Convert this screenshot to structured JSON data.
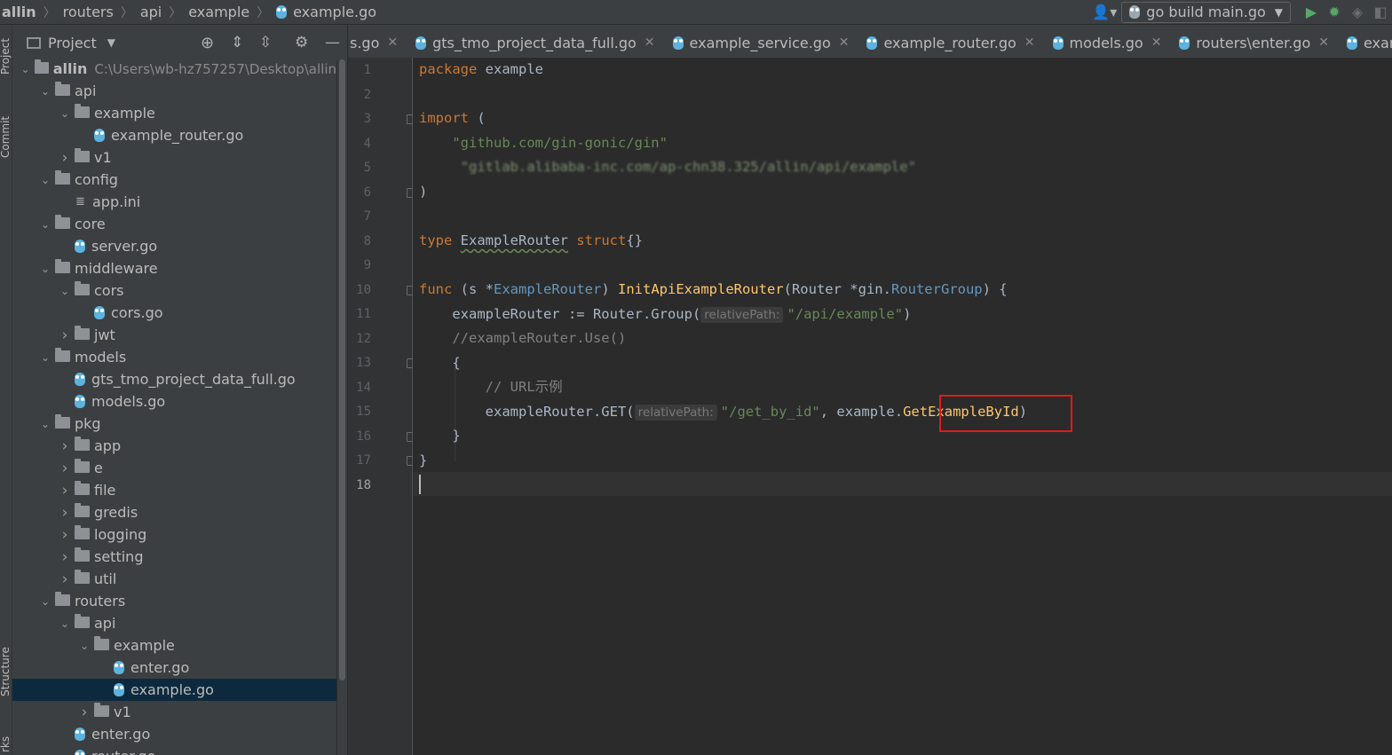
{
  "breadcrumb": [
    "allin",
    "routers",
    "api",
    "example",
    "example.go"
  ],
  "toolbar": {
    "run_config_label": "go build main.go",
    "icons": [
      "user-icon",
      "run-icon",
      "debug-icon",
      "coverage-icon",
      "stop-icon"
    ]
  },
  "side_strip": {
    "top_label": "Project",
    "mid_label": "Commit",
    "bottom_label": "Structure",
    "bottom2_label": "rks"
  },
  "project_panel": {
    "title": "Project",
    "root_name": "allin",
    "root_path": "C:\\Users\\wb-hz757257\\Desktop\\allin",
    "tree": [
      {
        "label": "api",
        "type": "folder",
        "expanded": true,
        "depth": 1
      },
      {
        "label": "example",
        "type": "folder",
        "expanded": true,
        "depth": 2
      },
      {
        "label": "example_router.go",
        "type": "go",
        "depth": 3
      },
      {
        "label": "v1",
        "type": "folder",
        "expanded": false,
        "depth": 2
      },
      {
        "label": "config",
        "type": "folder",
        "expanded": true,
        "depth": 1
      },
      {
        "label": "app.ini",
        "type": "ini",
        "depth": 2
      },
      {
        "label": "core",
        "type": "folder",
        "expanded": true,
        "depth": 1
      },
      {
        "label": "server.go",
        "type": "go",
        "depth": 2
      },
      {
        "label": "middleware",
        "type": "folder",
        "expanded": true,
        "depth": 1
      },
      {
        "label": "cors",
        "type": "folder",
        "expanded": true,
        "depth": 2
      },
      {
        "label": "cors.go",
        "type": "go",
        "depth": 3
      },
      {
        "label": "jwt",
        "type": "folder",
        "expanded": false,
        "depth": 2
      },
      {
        "label": "models",
        "type": "folder",
        "expanded": true,
        "depth": 1
      },
      {
        "label": "gts_tmo_project_data_full.go",
        "type": "go",
        "depth": 2
      },
      {
        "label": "models.go",
        "type": "go",
        "depth": 2
      },
      {
        "label": "pkg",
        "type": "folder",
        "expanded": true,
        "depth": 1
      },
      {
        "label": "app",
        "type": "folder",
        "expanded": false,
        "depth": 2
      },
      {
        "label": "e",
        "type": "folder",
        "expanded": false,
        "depth": 2
      },
      {
        "label": "file",
        "type": "folder",
        "expanded": false,
        "depth": 2
      },
      {
        "label": "gredis",
        "type": "folder",
        "expanded": false,
        "depth": 2
      },
      {
        "label": "logging",
        "type": "folder",
        "expanded": false,
        "depth": 2
      },
      {
        "label": "setting",
        "type": "folder",
        "expanded": false,
        "depth": 2
      },
      {
        "label": "util",
        "type": "folder",
        "expanded": false,
        "depth": 2
      },
      {
        "label": "routers",
        "type": "folder",
        "expanded": true,
        "depth": 1
      },
      {
        "label": "api",
        "type": "folder",
        "expanded": true,
        "depth": 2
      },
      {
        "label": "example",
        "type": "folder",
        "expanded": true,
        "depth": 3
      },
      {
        "label": "enter.go",
        "type": "go",
        "depth": 4
      },
      {
        "label": "example.go",
        "type": "go",
        "depth": 4,
        "selected": true
      },
      {
        "label": "v1",
        "type": "folder",
        "expanded": false,
        "depth": 3
      },
      {
        "label": "enter.go",
        "type": "go",
        "depth": 2
      },
      {
        "label": "router.go",
        "type": "go",
        "depth": 2
      }
    ]
  },
  "tabs": [
    {
      "label": "s.go",
      "icon": false
    },
    {
      "label": "gts_tmo_project_data_full.go",
      "icon": true
    },
    {
      "label": "example_service.go",
      "icon": true
    },
    {
      "label": "example_router.go",
      "icon": true
    },
    {
      "label": "models.go",
      "icon": true
    },
    {
      "label": "routers\\enter.go",
      "icon": true
    },
    {
      "label": "example\\",
      "icon": true
    }
  ],
  "editor": {
    "current_line": 18,
    "line_numbers": [
      "1",
      "2",
      "3",
      "4",
      "5",
      "6",
      "7",
      "8",
      "9",
      "10",
      "11",
      "12",
      "13",
      "14",
      "15",
      "16",
      "17",
      "18"
    ],
    "code": {
      "l1_kw": "package",
      "l1_name": " example",
      "l3_kw": "import",
      "l3_paren": " (",
      "l4_str": "\"github.com/gin-gonic/gin\"",
      "l5_blur": "\"gitlab.alibaba-inc.com/ap-chn38.325/allin/api/example\"",
      "l6": ")",
      "l8_kw": "type",
      "l8_name": "ExampleRouter",
      "l8_kw2": "struct",
      "l8_rest": "{}",
      "l10_kw": "func",
      "l10_a": " (s *",
      "l10_recv": "ExampleRouter",
      "l10_b": ") ",
      "l10_fn": "InitApiExampleRouter",
      "l10_c": "(Router *gin.",
      "l10_type": "RouterGroup",
      "l10_d": ") {",
      "l11_a": "exampleRouter := Router.Group(",
      "l11_hint": "relativePath:",
      "l11_str": "\"/api/example\"",
      "l11_b": ")",
      "l12_cmt": "//exampleRouter.Use()",
      "l13": "{",
      "l14_cmt": "// URL示例",
      "l15_a": "exampleRouter.GET(",
      "l15_hint": "relativePath:",
      "l15_str": "\"/get_by_id\"",
      "l15_b": ", example.",
      "l15_fn": "GetExampleById",
      "l15_c": ")",
      "l16": "}",
      "l17": "}"
    }
  }
}
